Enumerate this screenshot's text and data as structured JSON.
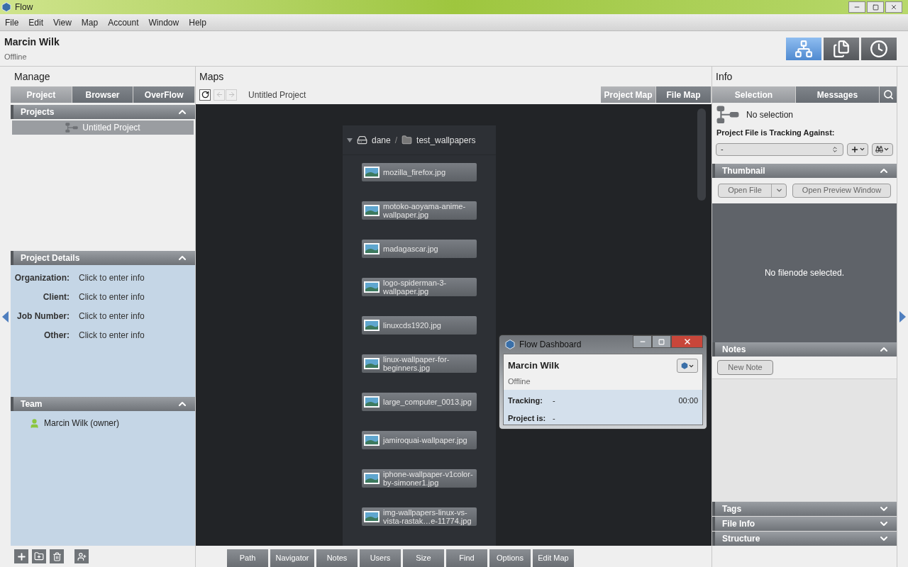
{
  "window": {
    "title": "Flow"
  },
  "menu": [
    "File",
    "Edit",
    "View",
    "Map",
    "Account",
    "Window",
    "Help"
  ],
  "user": {
    "name": "Marcin Wilk",
    "status": "Offline"
  },
  "mode_buttons": [
    {
      "kind": "map",
      "selected": true
    },
    {
      "kind": "files",
      "selected": false
    },
    {
      "kind": "clock",
      "selected": false
    }
  ],
  "manage": {
    "title": "Manage",
    "tabs": [
      {
        "label": "Project",
        "selected": true
      },
      {
        "label": "Browser",
        "selected": false
      },
      {
        "label": "OverFlow",
        "selected": false
      }
    ],
    "projects": {
      "title": "Projects",
      "expanded": true,
      "items": [
        {
          "label": "Untitled Project",
          "selected": true
        }
      ]
    },
    "details": {
      "title": "Project Details",
      "expanded": true,
      "fields": [
        {
          "label": "Organization:",
          "value": "Click to enter info"
        },
        {
          "label": "Client:",
          "value": "Click to enter info"
        },
        {
          "label": "Job Number:",
          "value": "Click to enter info"
        },
        {
          "label": "Other:",
          "value": "Click to enter info"
        }
      ]
    },
    "team": {
      "title": "Team",
      "expanded": true,
      "members": [
        "Marcin Wilk (owner)"
      ]
    }
  },
  "maps": {
    "title": "Maps",
    "breadcrumb": "Untitled Project",
    "tabs": [
      {
        "label": "Project Map",
        "selected": true
      },
      {
        "label": "File Map",
        "selected": false
      }
    ],
    "node": {
      "expanded": true,
      "drive": "dane",
      "separator": "/",
      "folder": "test_wallpapers",
      "files": [
        "mozilla_firefox.jpg",
        "motoko-aoyama-anime-wallpaper.jpg",
        "madagascar.jpg",
        "logo-spiderman-3-wallpaper.jpg",
        "linuxcds1920.jpg",
        "linux-wallpaper-for-beginners.jpg",
        "large_computer_0013.jpg",
        "jamiroquai-wallpaper.jpg",
        "iphone-wallpaper-v1color-by-simoner1.jpg",
        "img-wallpapers-linux-vs-vista-rastak…e-11774.jpg"
      ]
    },
    "bottom_tabs": [
      "Path",
      "Navigator",
      "Notes",
      "Users",
      "Size",
      "Find",
      "Options",
      "Edit Map"
    ]
  },
  "dashboard": {
    "title": "Flow Dashboard",
    "name": "Marcin Wilk",
    "status": "Offline",
    "time": "00:00",
    "fields": [
      {
        "label": "Tracking:",
        "value": "-"
      },
      {
        "label": "Project is:",
        "value": "-"
      }
    ]
  },
  "info": {
    "title": "Info",
    "tabs": [
      {
        "label": "Selection",
        "selected": true
      },
      {
        "label": "Messages",
        "selected": false
      }
    ],
    "selection": "No selection",
    "tracking_label": "Project File is Tracking Against:",
    "tracking_value": "-",
    "thumbnail": {
      "title": "Thumbnail",
      "expanded": true,
      "open_file": "Open File",
      "open_preview": "Open Preview Window",
      "empty": "No filenode selected."
    },
    "notes": {
      "title": "Notes",
      "expanded": true,
      "button": "New Note"
    },
    "collapsed_sections": [
      {
        "title": "Tags",
        "expanded": false
      },
      {
        "title": "File Info",
        "expanded": false
      },
      {
        "title": "Structure",
        "expanded": false
      }
    ]
  }
}
